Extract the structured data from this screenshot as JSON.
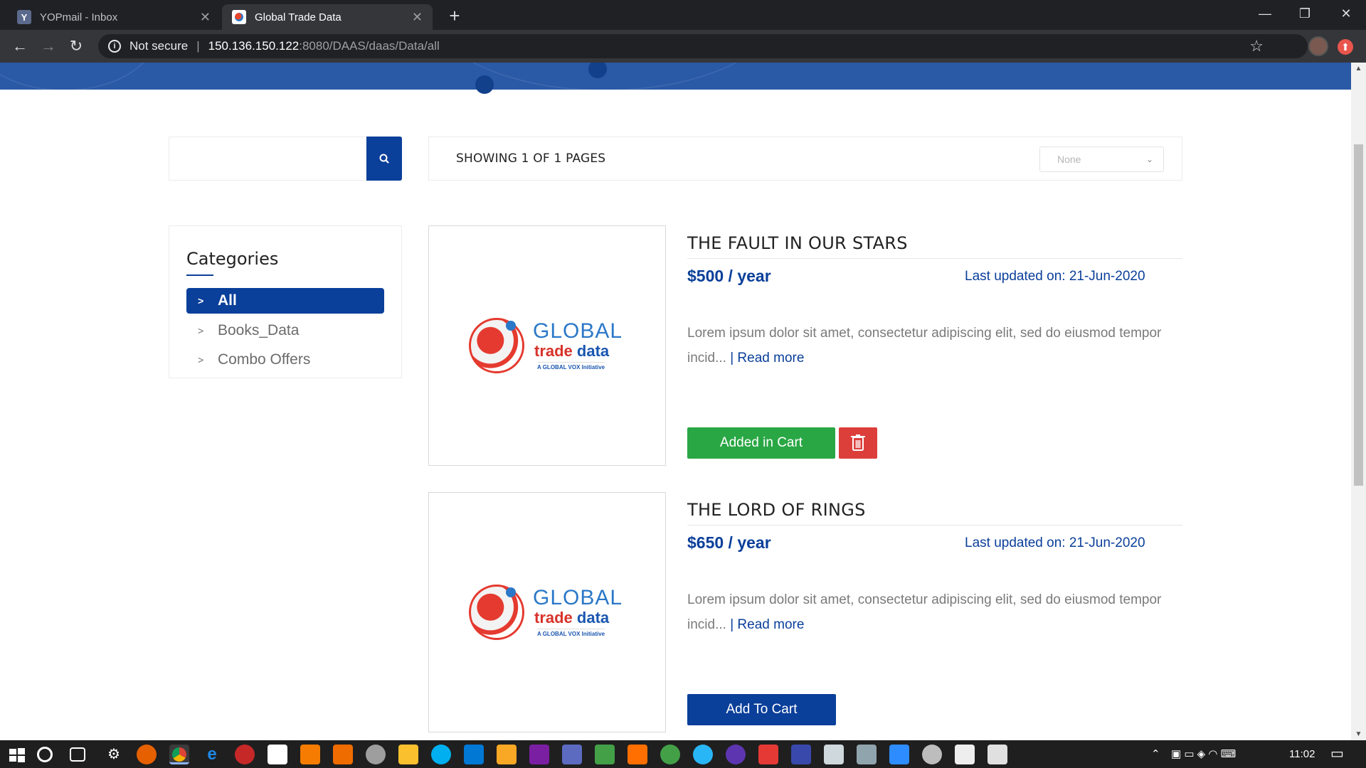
{
  "browser": {
    "tabs": [
      {
        "title": "YOPmail - Inbox",
        "icon": "yopmail-favicon",
        "active": false
      },
      {
        "title": "Global Trade Data",
        "icon": "globaltrade-favicon",
        "active": true
      }
    ],
    "url": {
      "security_label": "Not secure",
      "host": "150.136.150.122",
      "path": ":8080/DAAS/daas/Data/all"
    }
  },
  "page": {
    "search": {
      "placeholder": "",
      "value": "",
      "button_icon": "search-icon"
    },
    "pagination_text": "SHOWING 1 OF 1 PAGES",
    "sort": {
      "selected": "None"
    },
    "categories": {
      "title": "Categories",
      "items": [
        {
          "label": "All",
          "active": true
        },
        {
          "label": "Books_Data",
          "active": false
        },
        {
          "label": "Combo Offers",
          "active": false
        }
      ]
    },
    "products": [
      {
        "title": "THE FAULT IN OUR STARS",
        "price": "$500 / year",
        "updated": "Last updated on: 21-Jun-2020",
        "description": "Lorem ipsum dolor sit amet, consectetur adipiscing elit, sed do eiusmod tempor incid...",
        "read_more": "| Read more",
        "cart_label": "Added in Cart",
        "in_cart": true
      },
      {
        "title": "THE LORD OF RINGS",
        "price": "$650 / year",
        "updated": "Last updated on: 21-Jun-2020",
        "description": "Lorem ipsum dolor sit amet, consectetur adipiscing elit, sed do eiusmod tempor incid...",
        "read_more": "| Read more",
        "cart_label": "Add To Cart",
        "in_cart": false
      }
    ],
    "logo": {
      "line1": "GLOBAL",
      "line2a": "trade",
      "line2b": "data",
      "line3": "A GLOBAL VOX Initiative"
    }
  },
  "taskbar": {
    "clock": "11:02"
  },
  "colors": {
    "primary": "#0a3f9a",
    "success": "#2aa745",
    "danger": "#dc3f3a",
    "hero": "#2a59a6"
  }
}
